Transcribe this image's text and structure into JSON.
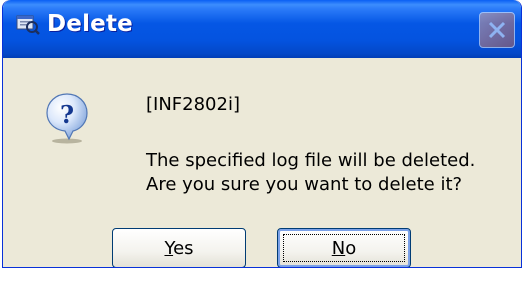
{
  "window": {
    "title": "Delete",
    "title_icon": "window-icon",
    "close_icon": "close-icon"
  },
  "dialog": {
    "icon": "question-icon",
    "code": "[INF2802i]",
    "message_line1": "The specified log file will be deleted.",
    "message_line2": "Are you sure you want to delete it?"
  },
  "buttons": {
    "yes": {
      "mnemonic": "Y",
      "rest": "es"
    },
    "no": {
      "mnemonic": "N",
      "rest": "o"
    }
  },
  "colors": {
    "titlebar": "#0453DF",
    "dialog_bg": "#ECE9D8",
    "button_border": "#003C74"
  }
}
